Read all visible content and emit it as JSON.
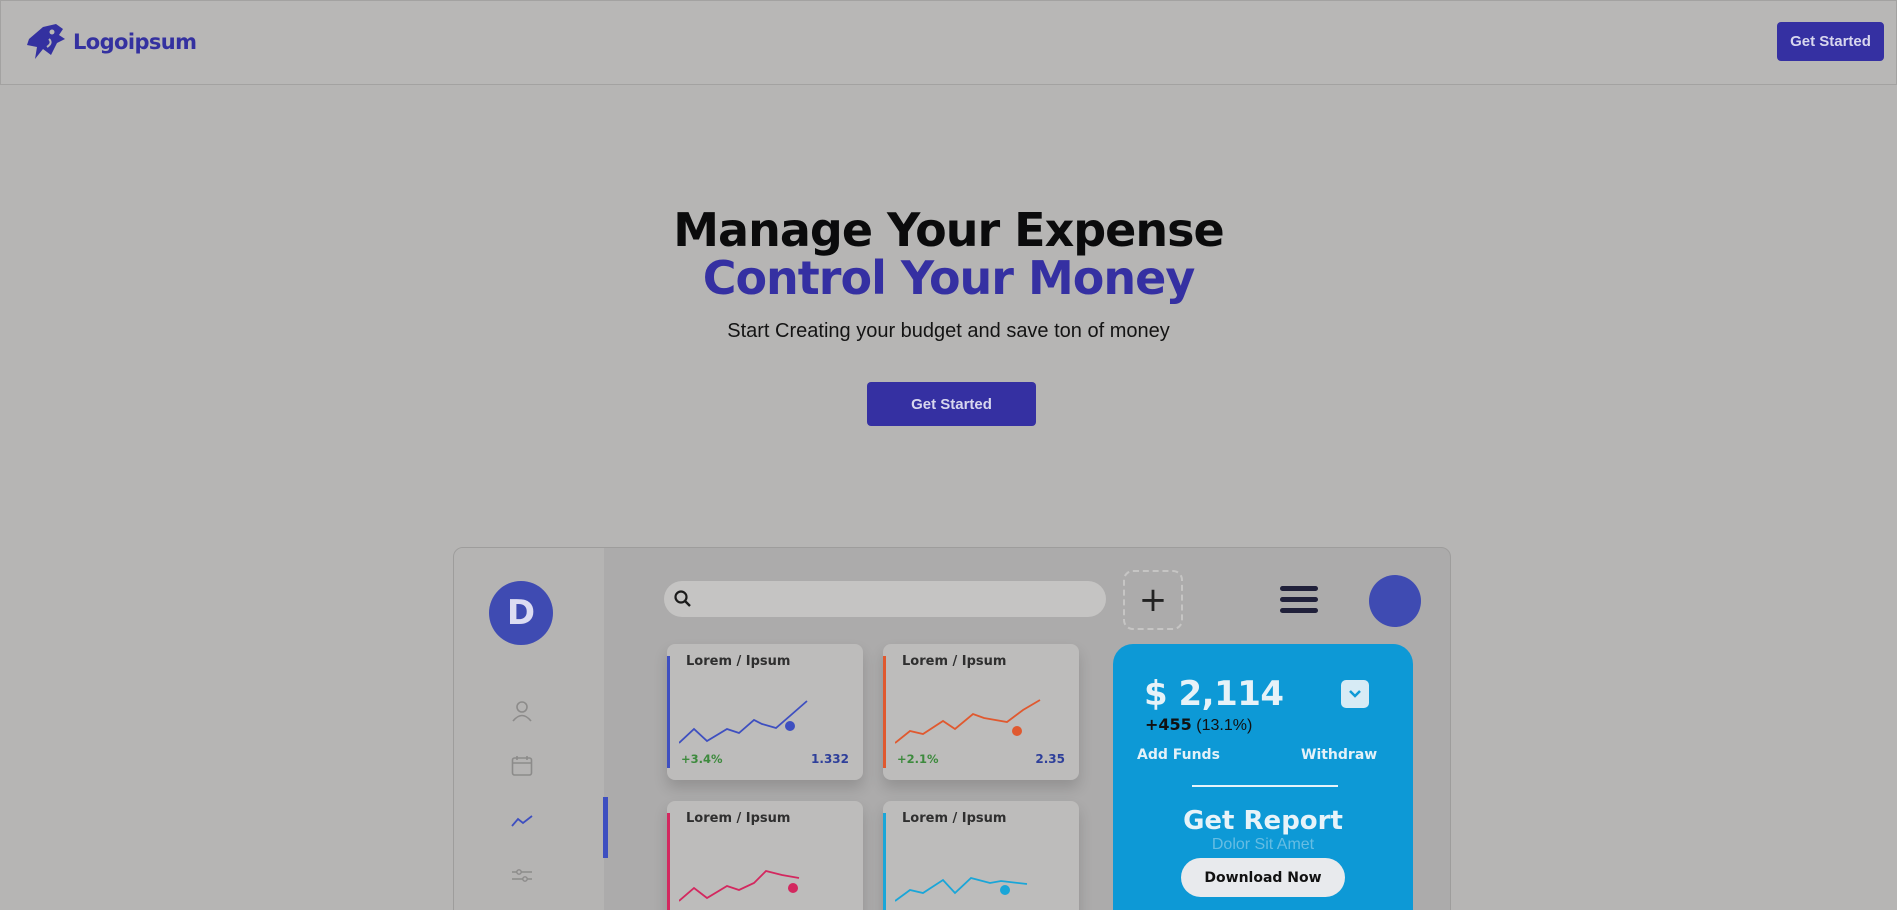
{
  "header": {
    "logo_text": "Logoipsum",
    "get_started_label": "Get Started"
  },
  "hero": {
    "line1": "Manage Your Expense",
    "line2": "Control Your Money",
    "subtitle": "Start Creating your budget and save ton of money",
    "cta_label": "Get Started"
  },
  "dashboard": {
    "avatar_letter": "D",
    "plus_label": "+",
    "cards": [
      {
        "title": "Lorem / Ipsum",
        "change": "+3.4%",
        "value": "1.332",
        "color": "#3e4fc0"
      },
      {
        "title": "Lorem / Ipsum",
        "change": "+2.1%",
        "value": "2.35",
        "color": "#e0592f"
      },
      {
        "title": "Lorem / Ipsum",
        "change": "",
        "value": "",
        "color": "#d3285f"
      },
      {
        "title": "Lorem / Ipsum",
        "change": "",
        "value": "",
        "color": "#1aa6d8"
      }
    ],
    "funds": {
      "balance": "$ 2,114",
      "change_amount": "+455",
      "change_percent": "(13.1%)",
      "add_funds": "Add Funds",
      "withdraw": "Withdraw",
      "report_title": "Get Report",
      "report_subtitle": "Dolor Sit Amet",
      "download_label": "Download Now"
    }
  },
  "colors": {
    "brand": "#3530a2",
    "funds_card": "#0d99d6"
  }
}
